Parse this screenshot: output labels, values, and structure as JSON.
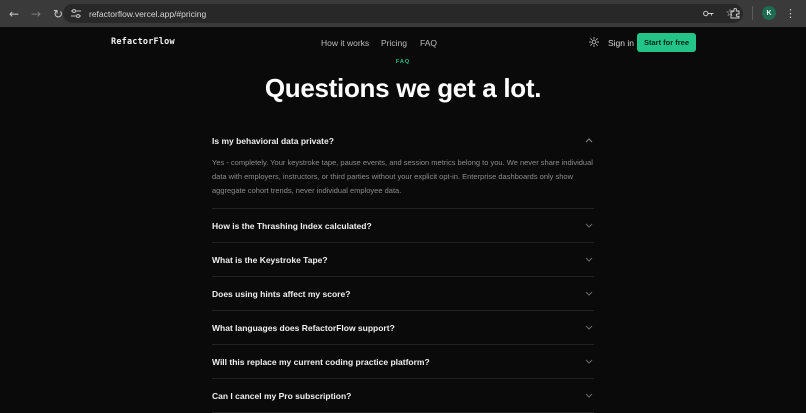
{
  "browser": {
    "url": "refactorflow.vercel.app/#pricing",
    "profile_initial": "K",
    "icons": [
      "back-icon",
      "forward-icon",
      "reload-icon",
      "site-settings-icon",
      "password-key-icon",
      "bookmark-star-icon",
      "extensions-icon",
      "menu-icon"
    ]
  },
  "nav": {
    "brand": "RefactorFlow",
    "links": [
      "How it works",
      "Pricing",
      "FAQ"
    ],
    "signin": "Sign in",
    "cta": "Start for free",
    "theme_icon": "sun-icon"
  },
  "faq": {
    "eyebrow": "FAQ",
    "title": "Questions we get a lot.",
    "items": [
      {
        "question": "Is my behavioral data private?",
        "expanded": true,
        "answer": "Yes - completely. Your keystroke tape, pause events, and session metrics belong to you. We never share individual data with employers, instructors, or third parties without your explicit opt-in. Enterprise dashboards only show aggregate cohort trends, never individual employee data."
      },
      {
        "question": "How is the Thrashing Index calculated?",
        "expanded": false
      },
      {
        "question": "What is the Keystroke Tape?",
        "expanded": false
      },
      {
        "question": "Does using hints affect my score?",
        "expanded": false
      },
      {
        "question": "What languages does RefactorFlow support?",
        "expanded": false
      },
      {
        "question": "Will this replace my current coding practice platform?",
        "expanded": false
      },
      {
        "question": "Can I cancel my Pro subscription?",
        "expanded": false
      }
    ]
  },
  "colors": {
    "accent": "#22c487",
    "background": "#0a0a0a"
  }
}
